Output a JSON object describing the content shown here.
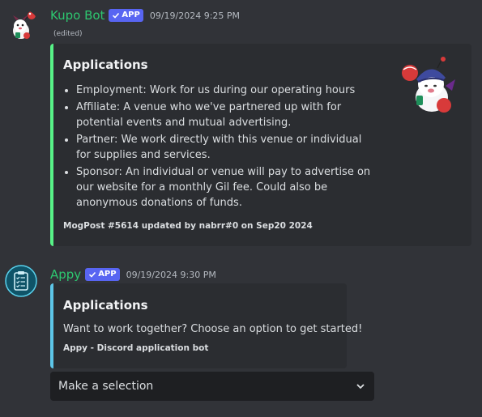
{
  "messages": [
    {
      "username": "Kupo Bot",
      "username_color": "#2dc770",
      "badge": "APP",
      "timestamp": "09/19/2024 9:25 PM",
      "edited": "(edited)",
      "embed": {
        "color": "#57f287",
        "title": "Applications",
        "items": [
          "Employment: Work for us during our operating hours",
          "Affiliate: A venue who we've partnered up with for potential events and mutual advertising.",
          "Partner: We work directly with this venue or individual for supplies and services.",
          "Sponsor: An individual or venue will pay to advertise on our website for a monthly Gil fee. Could also be anonymous donations of funds."
        ],
        "footer": "MogPost #5614 updated by nabrr#0 on Sep20 2024"
      }
    },
    {
      "username": "Appy",
      "username_color": "#2dc770",
      "badge": "APP",
      "timestamp": "09/19/2024 9:30 PM",
      "embed": {
        "color": "#5dc6e8",
        "title": "Applications",
        "description": "Want to work together? Choose an option to get started!",
        "footer": "Appy - Discord application bot"
      },
      "select": {
        "placeholder": "Make a selection"
      }
    }
  ],
  "icons": {
    "badge_check": "check-icon",
    "select_chevron": "chevron-down-icon",
    "avatar1": "moogle-avatar",
    "avatar2": "clipboard-checklist-icon",
    "thumbnail": "moogle-thumbnail"
  }
}
